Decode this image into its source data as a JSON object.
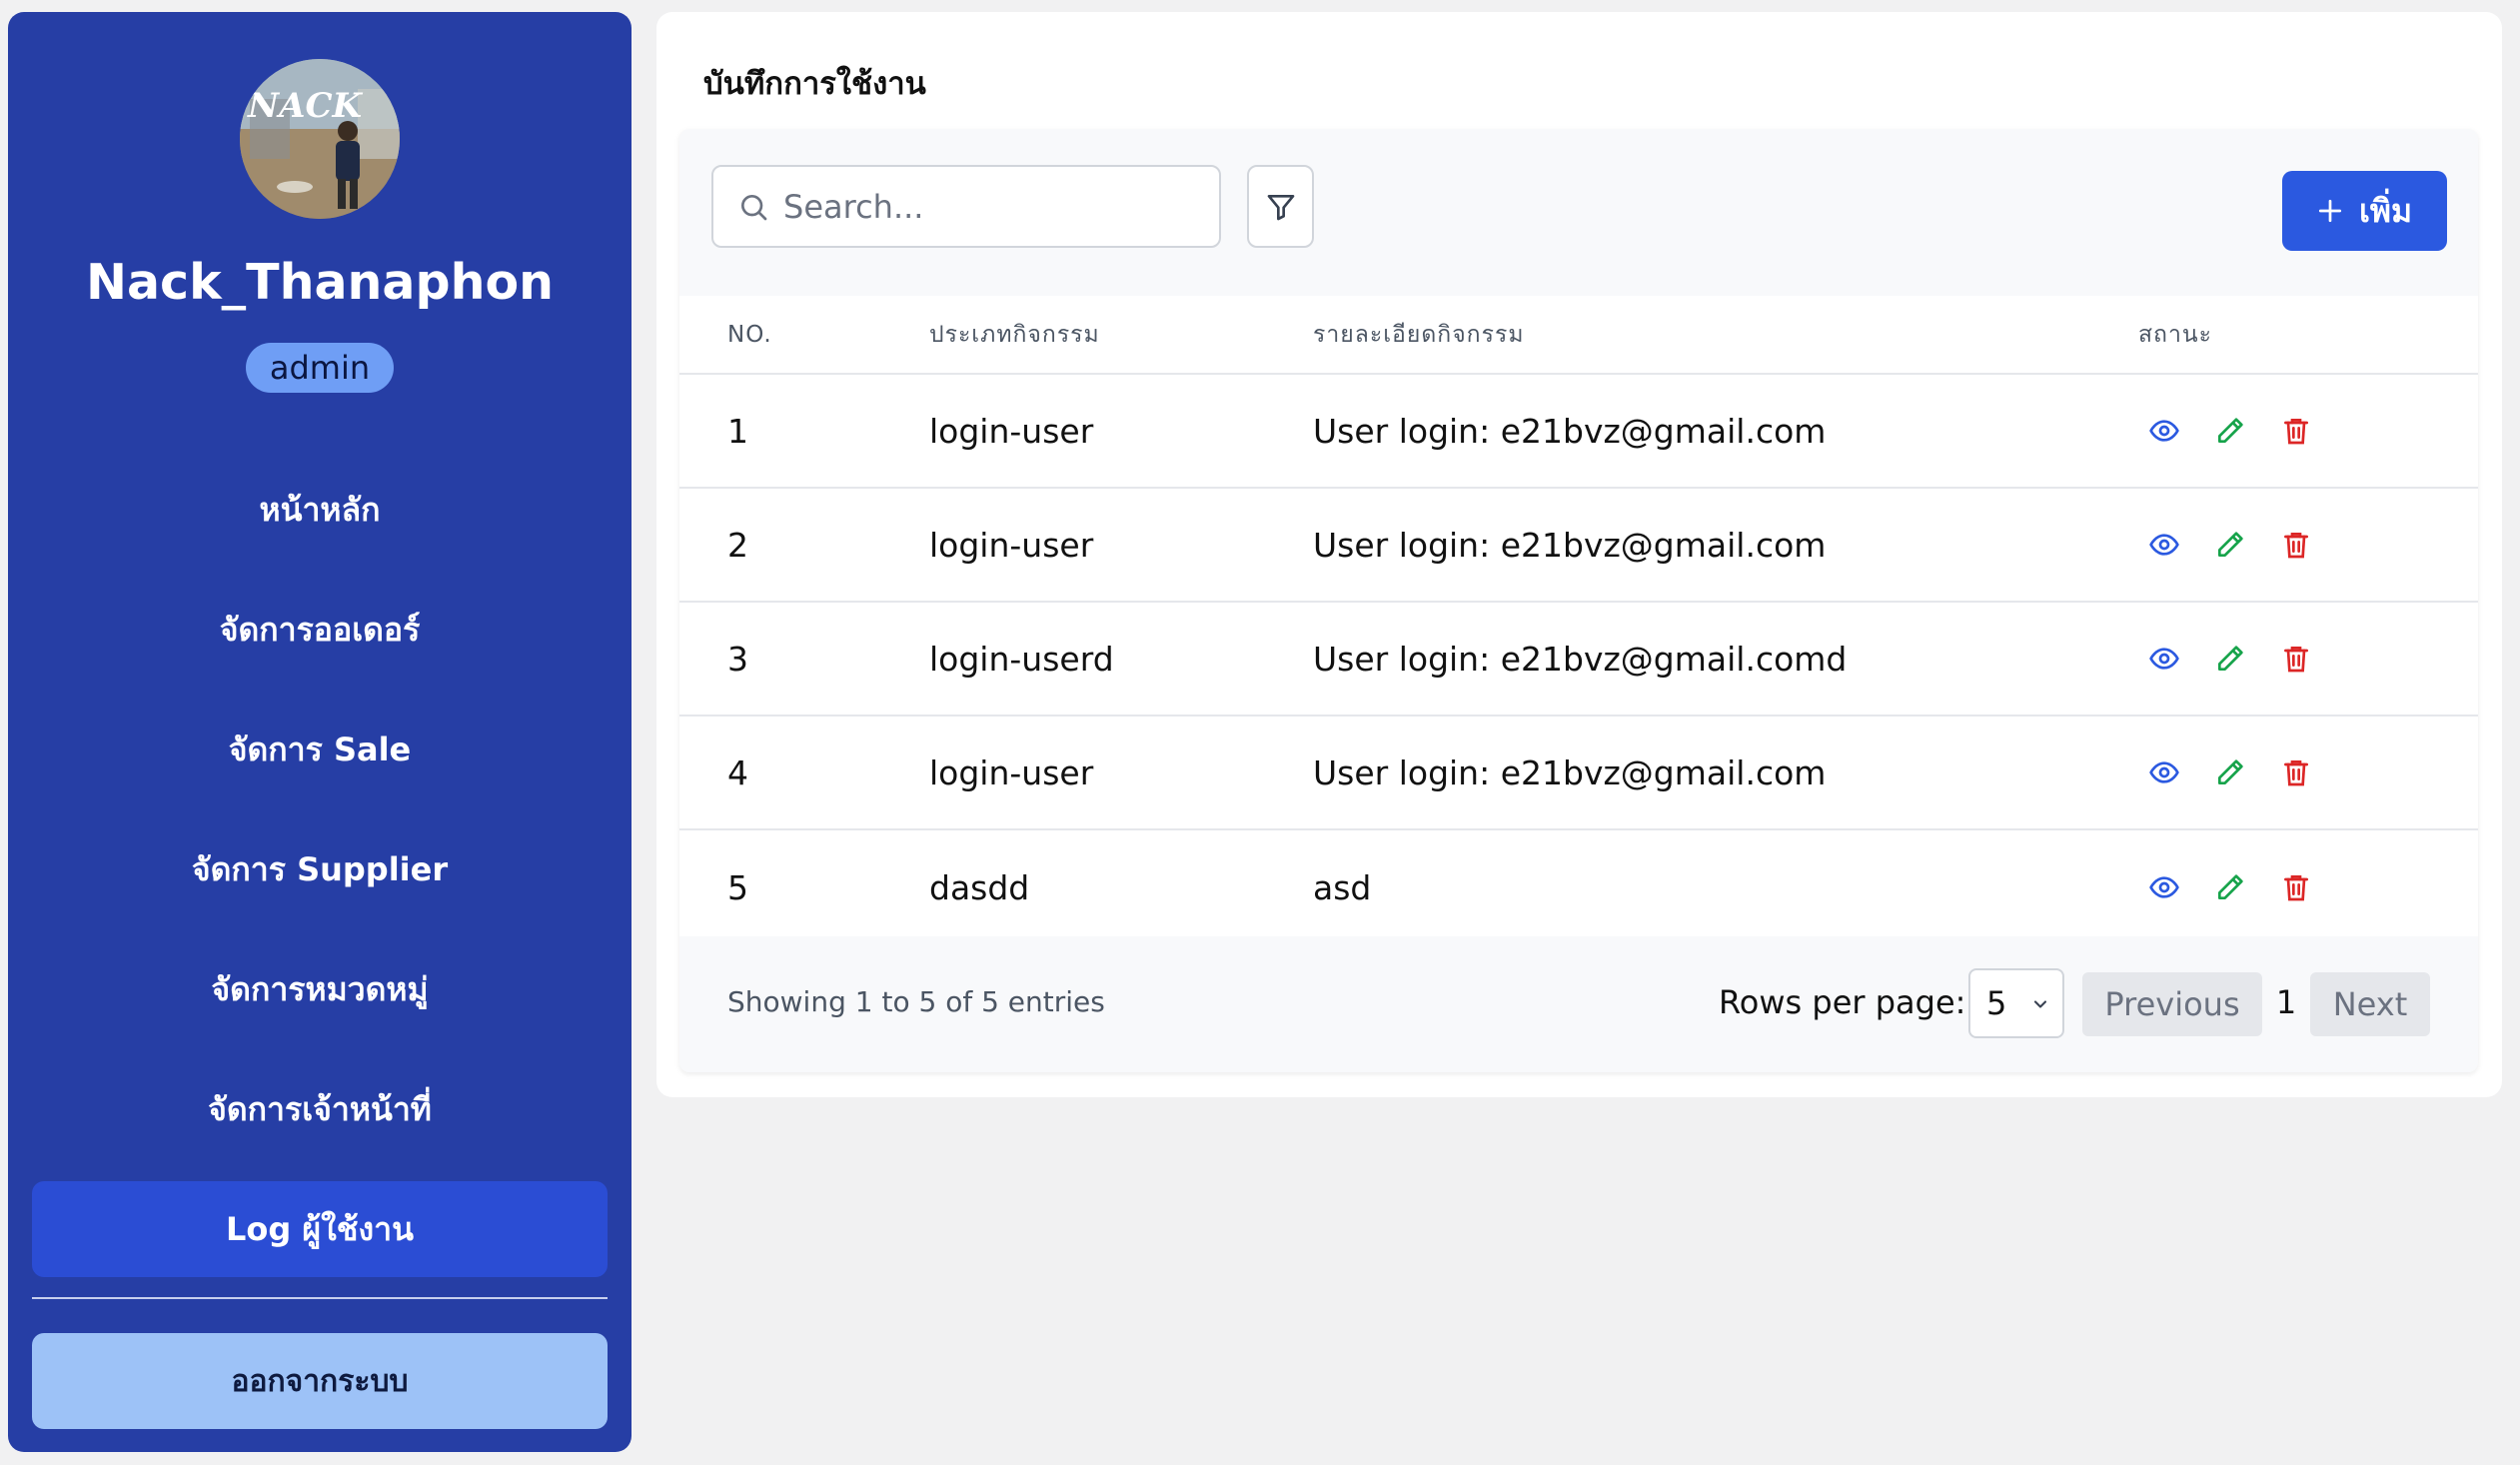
{
  "sidebar": {
    "avatar_text": "NACK",
    "username": "Nack_Thanaphon",
    "role": "admin",
    "items": [
      {
        "label": "หน้าหลัก"
      },
      {
        "label": "จัดการออเดอร์"
      },
      {
        "label": "จัดการ Sale"
      },
      {
        "label": "จัดการ Supplier"
      },
      {
        "label": "จัดการหมวดหมู่"
      },
      {
        "label": "จัดการเจ้าหน้าที่"
      },
      {
        "label": "Log ผู้ใช้งาน"
      }
    ],
    "active_index": 6,
    "logout_label": "ออกจากระบบ"
  },
  "main": {
    "title": "บันทึกการใช้งาน",
    "search": {
      "placeholder": "Search...",
      "value": ""
    },
    "add_label": "เพิ่ม",
    "table": {
      "headers": [
        "NO.",
        "ประเภทกิจกรรม",
        "รายละเอียดกิจกรรม",
        "สถานะ"
      ],
      "rows": [
        {
          "no": "1",
          "type": "login-user",
          "detail": "User login: e21bvz@gmail.com"
        },
        {
          "no": "2",
          "type": "login-user",
          "detail": "User login: e21bvz@gmail.com"
        },
        {
          "no": "3",
          "type": "login-userd",
          "detail": "User login: e21bvz@gmail.comd"
        },
        {
          "no": "4",
          "type": "login-user",
          "detail": "User login: e21bvz@gmail.com"
        },
        {
          "no": "5",
          "type": "dasdd",
          "detail": "asd"
        }
      ]
    },
    "footer": {
      "entries_text": "Showing 1 to 5 of 5 entries",
      "rows_per_page_label": "Rows per page:",
      "rows_per_page_value": "5",
      "previous_label": "Previous",
      "current_page": "1",
      "next_label": "Next"
    }
  },
  "colors": {
    "sidebar_bg": "#263ea5",
    "active_item_bg": "#2b4dd4",
    "logout_bg": "#9dc2f7",
    "accent": "#2b59e0",
    "view_icon": "#2b59e0",
    "edit_icon": "#16a34a",
    "delete_icon": "#dc2626"
  },
  "icons": {
    "search": "search-icon",
    "filter": "filter-icon",
    "add": "plus-icon",
    "view": "eye-icon",
    "edit": "pencil-icon",
    "delete": "trash-icon"
  }
}
